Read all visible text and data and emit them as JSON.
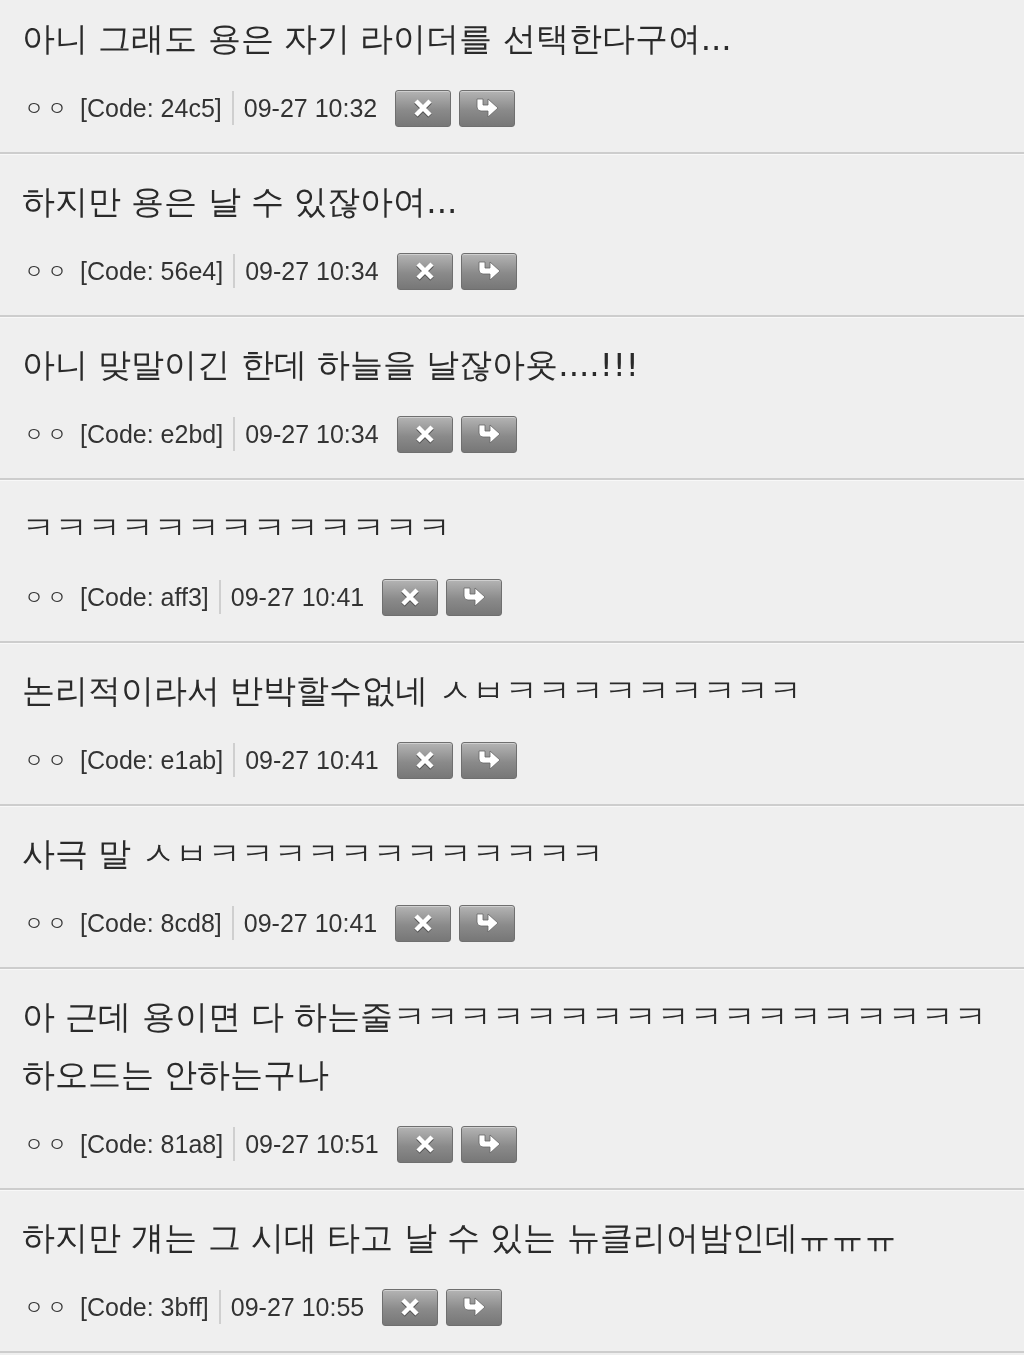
{
  "comments": [
    {
      "text": "아니 그래도 용은 자기 라이더를 선택한다구여...",
      "author": "ㅇㅇ",
      "code": "[Code: 24c5]",
      "time": "09-27 10:32"
    },
    {
      "text": "하지만 용은 날 수 있잖아여...",
      "author": "ㅇㅇ",
      "code": "[Code: 56e4]",
      "time": "09-27 10:34"
    },
    {
      "text": "아니 맞말이긴 한데 하늘을 날잖아욧....!!!",
      "author": "ㅇㅇ",
      "code": "[Code: e2bd]",
      "time": "09-27 10:34"
    },
    {
      "text": "ㅋㅋㅋㅋㅋㅋㅋㅋㅋㅋㅋㅋㅋ",
      "author": "ㅇㅇ",
      "code": "[Code: aff3]",
      "time": "09-27 10:41"
    },
    {
      "text": "논리적이라서 반박할수없네 ㅅㅂㅋㅋㅋㅋㅋㅋㅋㅋㅋ",
      "author": "ㅇㅇ",
      "code": "[Code: e1ab]",
      "time": "09-27 10:41"
    },
    {
      "text": "사극 말 ㅅㅂㅋㅋㅋㅋㅋㅋㅋㅋㅋㅋㅋㅋ",
      "author": "ㅇㅇ",
      "code": "[Code: 8cd8]",
      "time": "09-27 10:41"
    },
    {
      "text": "아 근데 용이면 다 하는줄ㅋㅋㅋㅋㅋㅋㅋㅋㅋㅋㅋㅋㅋㅋㅋㅋㅋㅋ 하오드는 안하는구나",
      "author": "ㅇㅇ",
      "code": "[Code: 81a8]",
      "time": "09-27 10:51"
    },
    {
      "text": "하지만 걔는 그 시대 타고 날 수 있는 뉴클리어밤인데ㅠㅠㅠ",
      "author": "ㅇㅇ",
      "code": "[Code: 3bff]",
      "time": "09-27 10:55"
    }
  ]
}
